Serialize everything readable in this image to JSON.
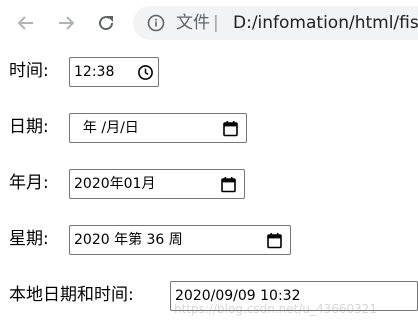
{
  "browser": {
    "page_label": "文件",
    "separator": "|",
    "url": "D:/infomation/html/fis"
  },
  "form": {
    "time": {
      "label": "时间:",
      "value": "12:38",
      "icon": "clock-icon"
    },
    "date": {
      "label": "日期:",
      "value": "  年 /月/日",
      "icon": "calendar-icon"
    },
    "month": {
      "label": "年月:",
      "value": "2020年01月",
      "icon": "calendar-icon"
    },
    "week": {
      "label": "星期:",
      "value": "2020 年第 36 周",
      "icon": "calendar-icon"
    },
    "datetime_local": {
      "label": "本地日期和时间:",
      "value": "2020/09/09 10:32"
    }
  },
  "watermark": "https://blog.csdn.net/u_43660321",
  "colors": {
    "omnibox_bg": "#f1f3f4",
    "nav_icon": "#5f6368",
    "field_border": "#767676"
  }
}
